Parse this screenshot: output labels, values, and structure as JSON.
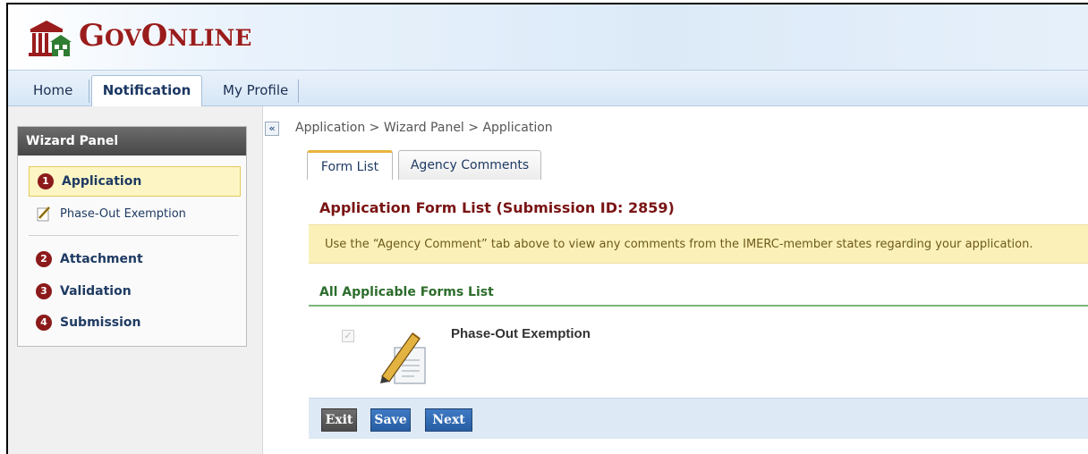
{
  "app": {
    "logo_big_1": "G",
    "logo_small_1": "OV",
    "logo_big_2": "O",
    "logo_small_2": "NLINE",
    "brand_color": "#9a1c1c"
  },
  "nav": {
    "tabs": [
      {
        "label": "Home"
      },
      {
        "label": "Notification",
        "selected": true
      },
      {
        "label": "My Profile"
      }
    ]
  },
  "wizard": {
    "title": "Wizard Panel",
    "steps": [
      {
        "number": "1",
        "label": "Application",
        "active": true
      },
      {
        "number": "2",
        "label": "Attachment"
      },
      {
        "number": "3",
        "label": "Validation"
      },
      {
        "number": "4",
        "label": "Submission"
      }
    ],
    "sub_item": {
      "label": "Phase-Out Exemption",
      "icon": "pencil-form-icon"
    },
    "collapse_glyph": "«"
  },
  "main": {
    "breadcrumb": "Application > Wizard Panel > Application",
    "tabs": [
      {
        "label": "Form List",
        "selected": true
      },
      {
        "label": "Agency Comments"
      }
    ],
    "section_title": "Application Form List (Submission ID: 2859)",
    "notice": "Use the “Agency Comment” tab above to view any comments from the IMERC-member states regarding your application.",
    "forms_heading": "All Applicable Forms List",
    "forms": [
      {
        "name": "Phase-Out Exemption",
        "checked": true,
        "checkbox_glyph": "✓"
      }
    ]
  },
  "actions": {
    "exit_label": "Exit",
    "save_label": "Save",
    "next_label": "Next"
  }
}
